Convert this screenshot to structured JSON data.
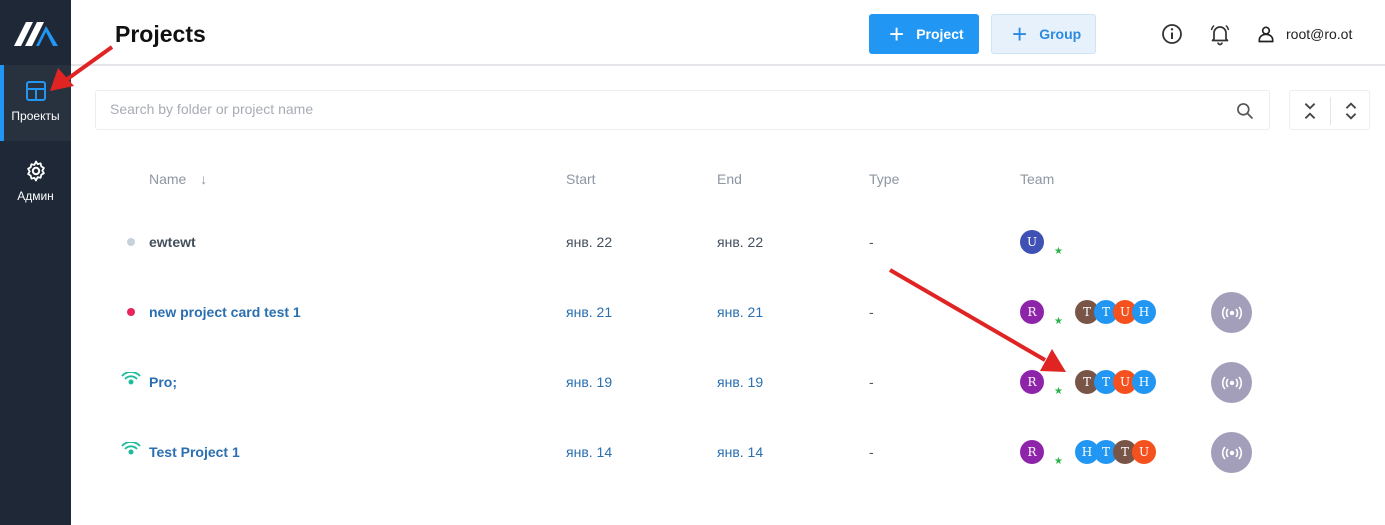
{
  "sidebar": {
    "items": [
      {
        "label": "Проекты",
        "icon": "dashboard-icon",
        "active": true
      },
      {
        "label": "Админ",
        "icon": "gear-icon",
        "active": false
      }
    ]
  },
  "header": {
    "title": "Projects",
    "project_button": "Project",
    "group_button": "Group",
    "user": "root@ro.ot"
  },
  "search": {
    "placeholder": "Search by folder or project name",
    "value": ""
  },
  "table": {
    "columns": [
      "Name",
      "Start",
      "End",
      "Type",
      "Team"
    ],
    "sort_indicator": "↓",
    "rows": [
      {
        "status": "gray-dot",
        "name": "ewtewt",
        "start": "янв. 22",
        "end": "янв. 22",
        "type": "-",
        "lead": "U",
        "members": [],
        "live": false
      },
      {
        "status": "red-dot",
        "name": "new project card test 1",
        "start": "янв. 21",
        "end": "янв. 21",
        "type": "-",
        "lead": "R",
        "members": [
          "T",
          "T",
          "U",
          "H"
        ],
        "live": true
      },
      {
        "status": "broadcast",
        "name": "Pro;",
        "start": "янв. 19",
        "end": "янв. 19",
        "type": "-",
        "lead": "R",
        "members": [
          "T",
          "T",
          "U",
          "H"
        ],
        "live": true
      },
      {
        "status": "broadcast",
        "name": "Test Project 1",
        "start": "янв. 14",
        "end": "янв. 14",
        "type": "-",
        "lead": "R",
        "members": [
          "H",
          "T",
          "T",
          "U"
        ],
        "live": true
      }
    ]
  },
  "colors": {
    "sidebar": "#1e2836",
    "accent": "#2196f3",
    "link": "#2a6fb0",
    "star": "#2ab24b",
    "annotation_arrow": "#e02424"
  }
}
